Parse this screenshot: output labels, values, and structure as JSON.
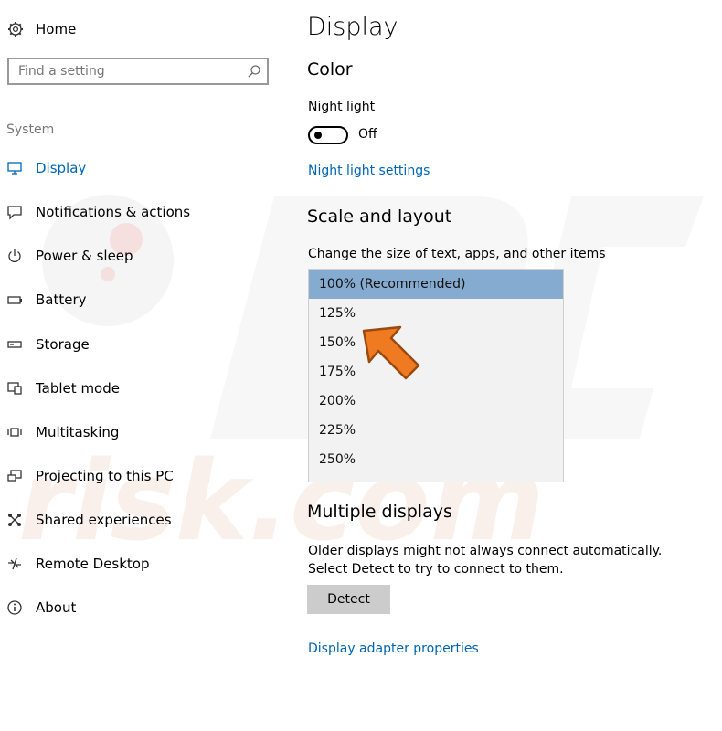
{
  "sidebar": {
    "home_label": "Home",
    "search_placeholder": "Find a setting",
    "section_label": "System",
    "items": [
      {
        "label": "Display",
        "icon": "monitor-icon",
        "active": true
      },
      {
        "label": "Notifications & actions",
        "icon": "message-icon"
      },
      {
        "label": "Power & sleep",
        "icon": "power-icon"
      },
      {
        "label": "Battery",
        "icon": "battery-icon"
      },
      {
        "label": "Storage",
        "icon": "drive-icon"
      },
      {
        "label": "Tablet mode",
        "icon": "tablet-icon"
      },
      {
        "label": "Multitasking",
        "icon": "multitasking-icon"
      },
      {
        "label": "Projecting to this PC",
        "icon": "projector-icon"
      },
      {
        "label": "Shared experiences",
        "icon": "share-icon"
      },
      {
        "label": "Remote Desktop",
        "icon": "remote-icon"
      },
      {
        "label": "About",
        "icon": "info-icon"
      }
    ]
  },
  "main": {
    "title": "Display",
    "color_heading": "Color",
    "night_light_label": "Night light",
    "night_light_state": "Off",
    "night_light_settings_link": "Night light settings",
    "scale_heading": "Scale and layout",
    "scale_label": "Change the size of text, apps, and other items",
    "scale_options": [
      "100% (Recommended)",
      "125%",
      "150%",
      "175%",
      "200%",
      "225%",
      "250%"
    ],
    "scale_selected": "100% (Recommended)",
    "multiple_heading": "Multiple displays",
    "multiple_desc": "Older displays might not always connect automatically. Select Detect to try to connect to them.",
    "detect_label": "Detect",
    "adapter_link": "Display adapter properties"
  },
  "colors": {
    "accent": "#0066b4",
    "selected_option": "#86abd0",
    "arrow": "#f07a22"
  }
}
